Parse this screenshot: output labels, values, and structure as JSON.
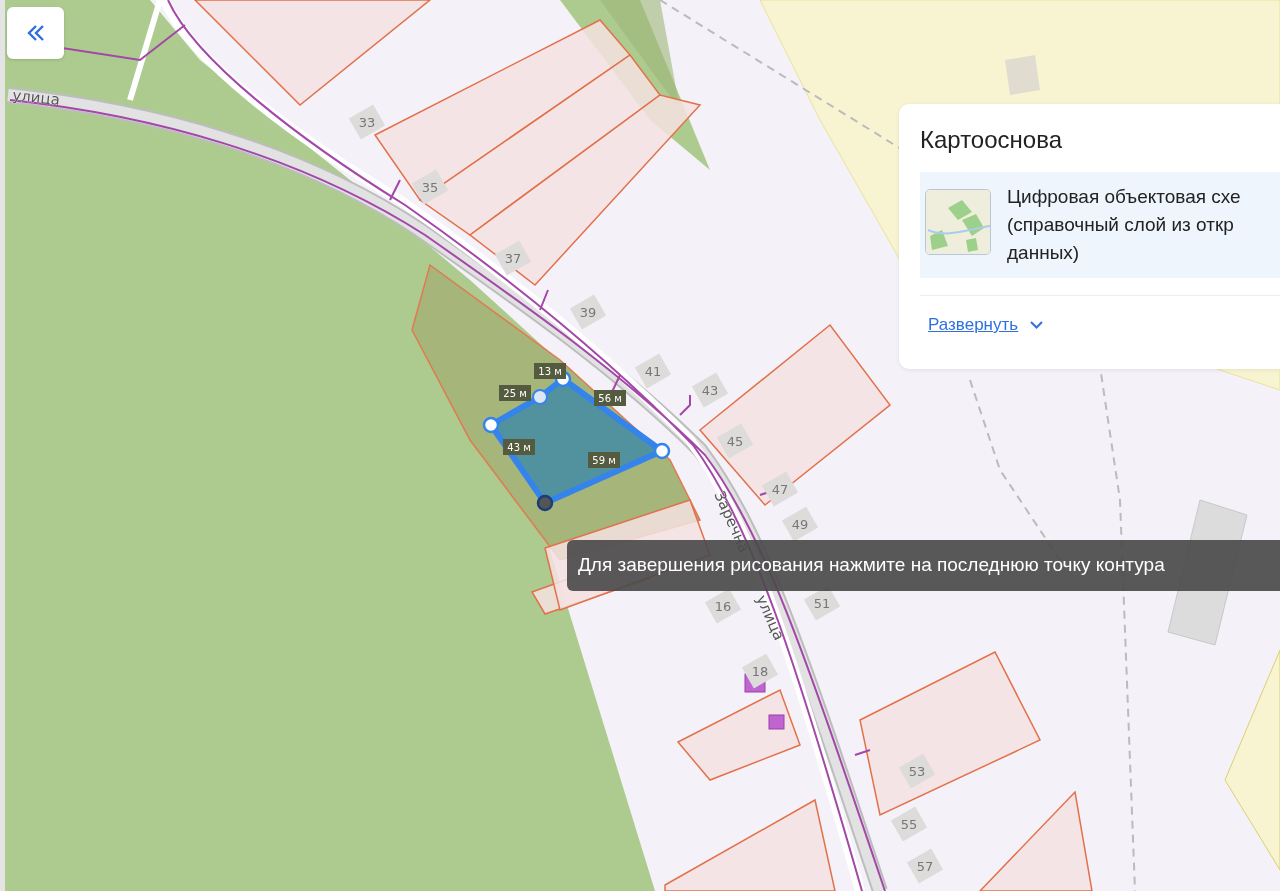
{
  "map": {
    "street_labels": [
      "улица",
      "Заречна",
      "улица"
    ],
    "house_numbers": [
      "33",
      "35",
      "37",
      "39",
      "41",
      "43",
      "45",
      "47",
      "49",
      "16",
      "51",
      "18",
      "53",
      "55",
      "57"
    ],
    "drawn_polygon": {
      "segment_labels": [
        "13 м",
        "25 м",
        "56 м",
        "43 м",
        "59 м"
      ]
    },
    "hint_tooltip": "Для завершения рисования нажмите на последнюю точку контура"
  },
  "layer_panel": {
    "title": "Картооснова",
    "layers": [
      {
        "lines": [
          "Цифровая объектовая схе",
          "(справочный слой из откр",
          "данных)"
        ],
        "selected": true
      }
    ],
    "expand_link": "Развернуть"
  }
}
